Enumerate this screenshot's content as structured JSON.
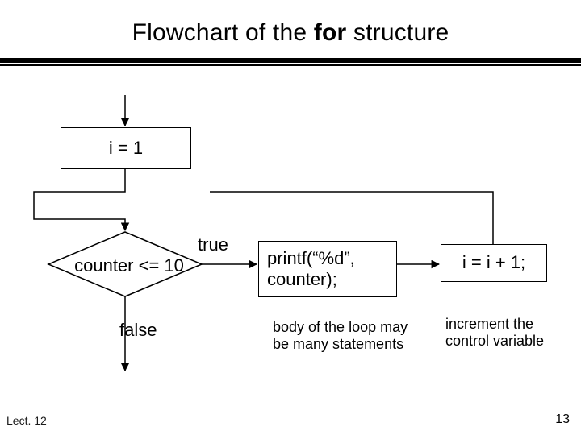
{
  "slide": {
    "title_pre": "Flowchart of the ",
    "title_for": "for",
    "title_post": " structure",
    "footer_left": "Lect. 12",
    "page_number": "13"
  },
  "flow": {
    "init_box": "i = 1",
    "decision": "counter <= 10",
    "true_label": "true",
    "false_label": "false",
    "printf_line1": "printf(“%d”,",
    "printf_line2": "counter);",
    "increment_box": "i = i + 1;",
    "body_note": "body of the loop may be many statements",
    "increment_note": "increment the control variable"
  }
}
